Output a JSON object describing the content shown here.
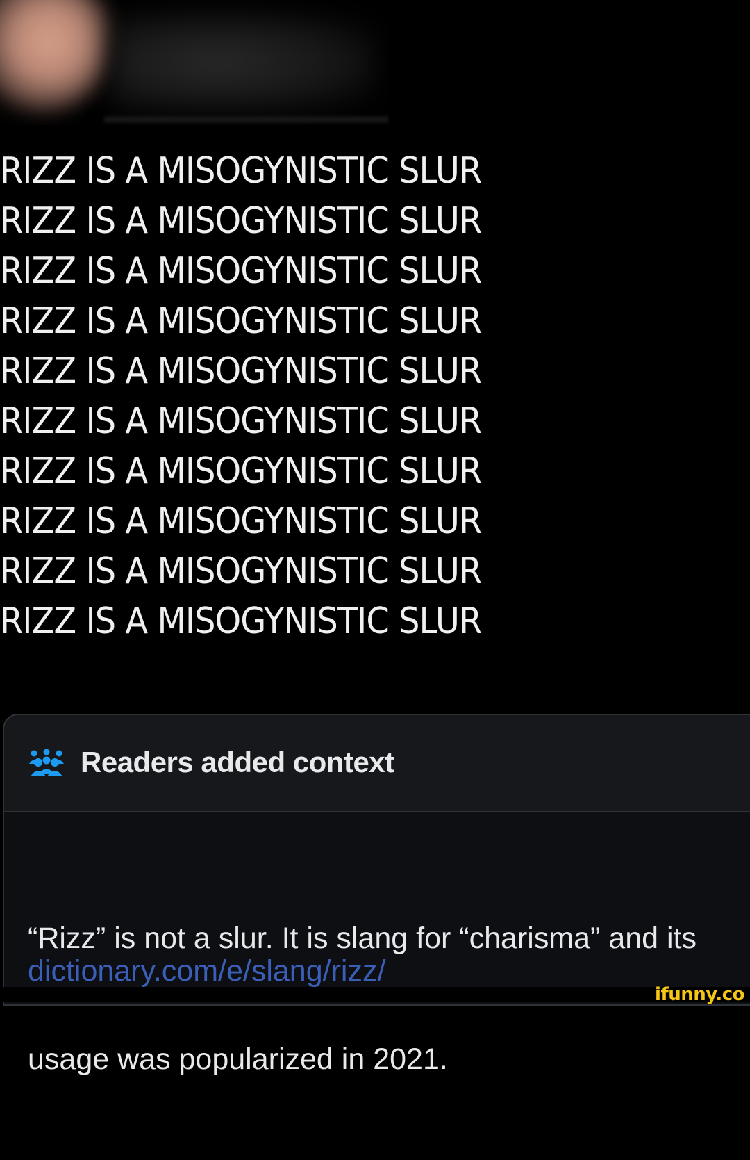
{
  "post": {
    "lines": [
      "RIZZ IS A MISOGYNISTIC SLUR",
      "RIZZ IS A MISOGYNISTIC SLUR",
      "RIZZ IS A MISOGYNISTIC SLUR",
      "RIZZ IS A MISOGYNISTIC SLUR",
      "RIZZ IS A MISOGYNISTIC SLUR",
      "RIZZ IS A MISOGYNISTIC SLUR",
      "RIZZ IS A MISOGYNISTIC SLUR",
      "RIZZ IS A MISOGYNISTIC SLUR",
      "RIZZ IS A MISOGYNISTIC SLUR",
      "RIZZ IS A MISOGYNISTIC SLUR"
    ]
  },
  "community_note": {
    "icon": "people-icon",
    "title": "Readers added context",
    "body_line1": "“Rizz” is not a slur. It is slang for “charisma” and its",
    "body_line2": "usage was popularized in 2021.",
    "link": "dictionary.com/e/slang/rizz/"
  },
  "watermark": {
    "text": "ifunny.co"
  },
  "colors": {
    "background": "#000000",
    "text": "#e7e9ea",
    "link": "#3b5fb8",
    "note_header": "#16181c",
    "icon": "#1d9bf0",
    "watermark": "#f5c518"
  }
}
